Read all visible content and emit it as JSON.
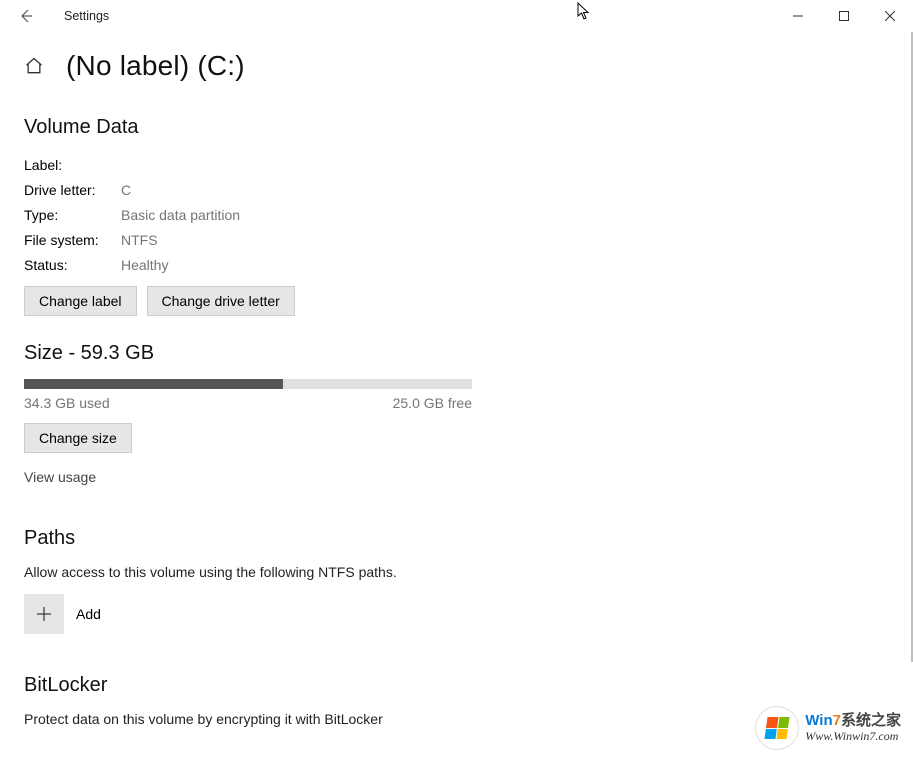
{
  "window": {
    "title": "Settings"
  },
  "page": {
    "title": "(No label) (C:)"
  },
  "volumeData": {
    "heading": "Volume Data",
    "labelKey": "Label:",
    "labelVal": "",
    "driveLetterKey": "Drive letter:",
    "driveLetterVal": "C",
    "typeKey": "Type:",
    "typeVal": "Basic data partition",
    "fsKey": "File system:",
    "fsVal": "NTFS",
    "statusKey": "Status:",
    "statusVal": "Healthy",
    "changeLabelBtn": "Change label",
    "changeDriveLetterBtn": "Change drive letter"
  },
  "size": {
    "heading": "Size - 59.3 GB",
    "usedText": "34.3 GB used",
    "freeText": "25.0 GB free",
    "usedGB": 34.3,
    "totalGB": 59.3,
    "changeSizeBtn": "Change size",
    "viewUsageLink": "View usage"
  },
  "paths": {
    "heading": "Paths",
    "desc": "Allow access to this volume using the following NTFS paths.",
    "addLabel": "Add"
  },
  "bitlocker": {
    "heading": "BitLocker",
    "desc": "Protect data on this volume by encrypting it with BitLocker"
  },
  "watermark": {
    "line1_prefix": "Win",
    "line1_seven": "7",
    "line1_cn": "系统之家",
    "line2": "Www.Winwin7.com"
  }
}
